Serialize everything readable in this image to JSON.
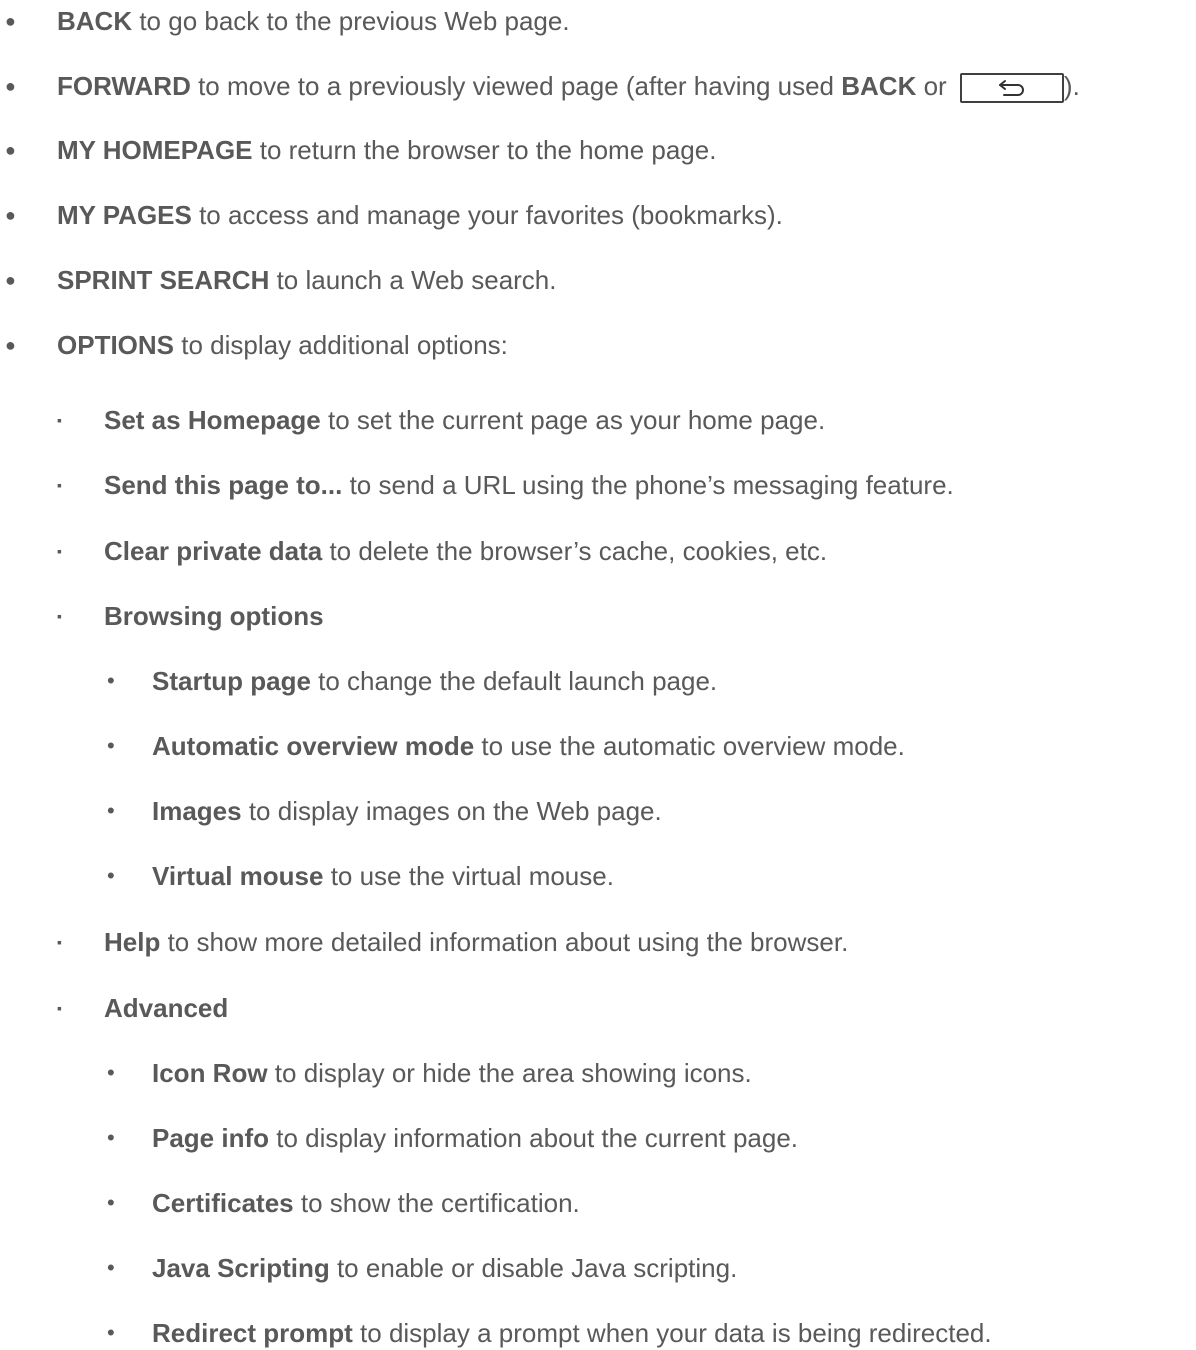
{
  "items": [
    {
      "level": 1,
      "term": "BACK",
      "text": " to go back to the previous Web page."
    },
    {
      "level": 1,
      "term": "FORWARD",
      "text": " to move to a previously viewed page (after having used ",
      "term2": "BACK",
      "text2": " or ",
      "key_icon": "back-key-icon",
      "text3": ")."
    },
    {
      "level": 1,
      "term": "MY HOMEPAGE",
      "text": " to return the browser to the home page."
    },
    {
      "level": 1,
      "term": "MY PAGES",
      "text": " to access and manage your favorites (bookmarks)."
    },
    {
      "level": 1,
      "term": "SPRINT SEARCH",
      "text": " to launch a Web search."
    },
    {
      "level": 1,
      "term": "OPTIONS",
      "text": " to display additional options:"
    },
    {
      "level": 2,
      "term": "Set as Homepage",
      "text": " to set the current page as your home page."
    },
    {
      "level": 2,
      "term": "Send this page to...",
      "text": " to send a URL using the phone’s messaging feature."
    },
    {
      "level": 2,
      "term": "Clear private data",
      "text": " to delete the browser’s cache, cookies, etc."
    },
    {
      "level": 2,
      "term": "Browsing options",
      "text": ""
    },
    {
      "level": 3,
      "term": "Startup page",
      "text": " to change the default launch page."
    },
    {
      "level": 3,
      "term": "Automatic overview mode",
      "text": " to use the automatic overview mode."
    },
    {
      "level": 3,
      "term": "Images",
      "text": " to display images on the Web page."
    },
    {
      "level": 3,
      "term": "Virtual mouse",
      "text": " to use the virtual mouse."
    },
    {
      "level": 2,
      "term": "Help",
      "text": " to show more detailed information about using the browser."
    },
    {
      "level": 2,
      "term": "Advanced",
      "text": ""
    },
    {
      "level": 3,
      "term": "Icon Row",
      "text": " to display or hide the area showing icons."
    },
    {
      "level": 3,
      "term": "Page info",
      "text": " to display information about the current page."
    },
    {
      "level": 3,
      "term": "Certificates",
      "text": " to show the certification."
    },
    {
      "level": 3,
      "term": "Java Scripting",
      "text": " to enable or disable Java scripting."
    },
    {
      "level": 3,
      "term": "Redirect prompt",
      "text": " to display a prompt when your data is being redirected."
    }
  ],
  "bullets": {
    "level1": "●",
    "level2": "▪",
    "level3": "•"
  },
  "colors": {
    "text": "#595959",
    "key_border": "#404040"
  }
}
